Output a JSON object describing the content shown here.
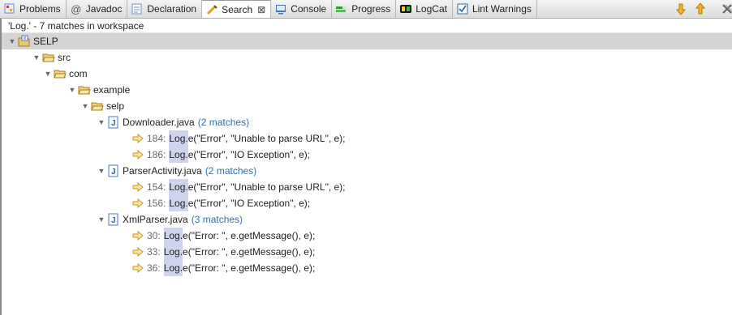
{
  "tabs": [
    {
      "name": "problems",
      "label": "Problems",
      "icon": "problems-icon"
    },
    {
      "name": "javadoc",
      "label": "Javadoc",
      "icon": "javadoc-icon"
    },
    {
      "name": "declaration",
      "label": "Declaration",
      "icon": "declaration-icon"
    },
    {
      "name": "search",
      "label": "Search",
      "icon": "search-icon",
      "active": true
    },
    {
      "name": "console",
      "label": "Console",
      "icon": "console-icon"
    },
    {
      "name": "progress",
      "label": "Progress",
      "icon": "progress-icon"
    },
    {
      "name": "logcat",
      "label": "LogCat",
      "icon": "logcat-icon"
    },
    {
      "name": "lint",
      "label": "Lint Warnings",
      "icon": "lint-warnings-icon"
    }
  ],
  "toolbar": {
    "next_icon": "arrow-down-icon",
    "prev_icon": "arrow-up-icon",
    "remove_icon": "remove-all-icon"
  },
  "status_text": "'Log.' - 7 matches in workspace",
  "tree": {
    "project": "SELP",
    "folders": [
      "src",
      "com",
      "example",
      "selp"
    ],
    "files": [
      {
        "name": "Downloader.java",
        "count": "(2 matches)",
        "matches": [
          {
            "line": "184:",
            "hit": "Log.",
            "rest": "e(\"Error\", \"Unable to parse URL\", e);"
          },
          {
            "line": "186:",
            "hit": "Log.",
            "rest": "e(\"Error\", \"IO Exception\", e);"
          }
        ]
      },
      {
        "name": "ParserActivity.java",
        "count": "(2 matches)",
        "matches": [
          {
            "line": "154:",
            "hit": "Log.",
            "rest": "e(\"Error\", \"Unable to parse URL\", e);"
          },
          {
            "line": "156:",
            "hit": "Log.",
            "rest": "e(\"Error\", \"IO Exception\", e);"
          }
        ]
      },
      {
        "name": "XmlParser.java",
        "count": "(3 matches)",
        "matches": [
          {
            "line": "30:",
            "hit": "Log.",
            "rest": "e(\"Error: \", e.getMessage(), e);"
          },
          {
            "line": "33:",
            "hit": "Log.",
            "rest": "e(\"Error: \", e.getMessage(), e);"
          },
          {
            "line": "36:",
            "hit": "Log.",
            "rest": "e(\"Error: \", e.getMessage(), e);"
          }
        ]
      }
    ]
  },
  "colors": {
    "highlight": "#cfd3ee",
    "count": "#2f6fb3",
    "selected_row": "#d4d4d4"
  }
}
